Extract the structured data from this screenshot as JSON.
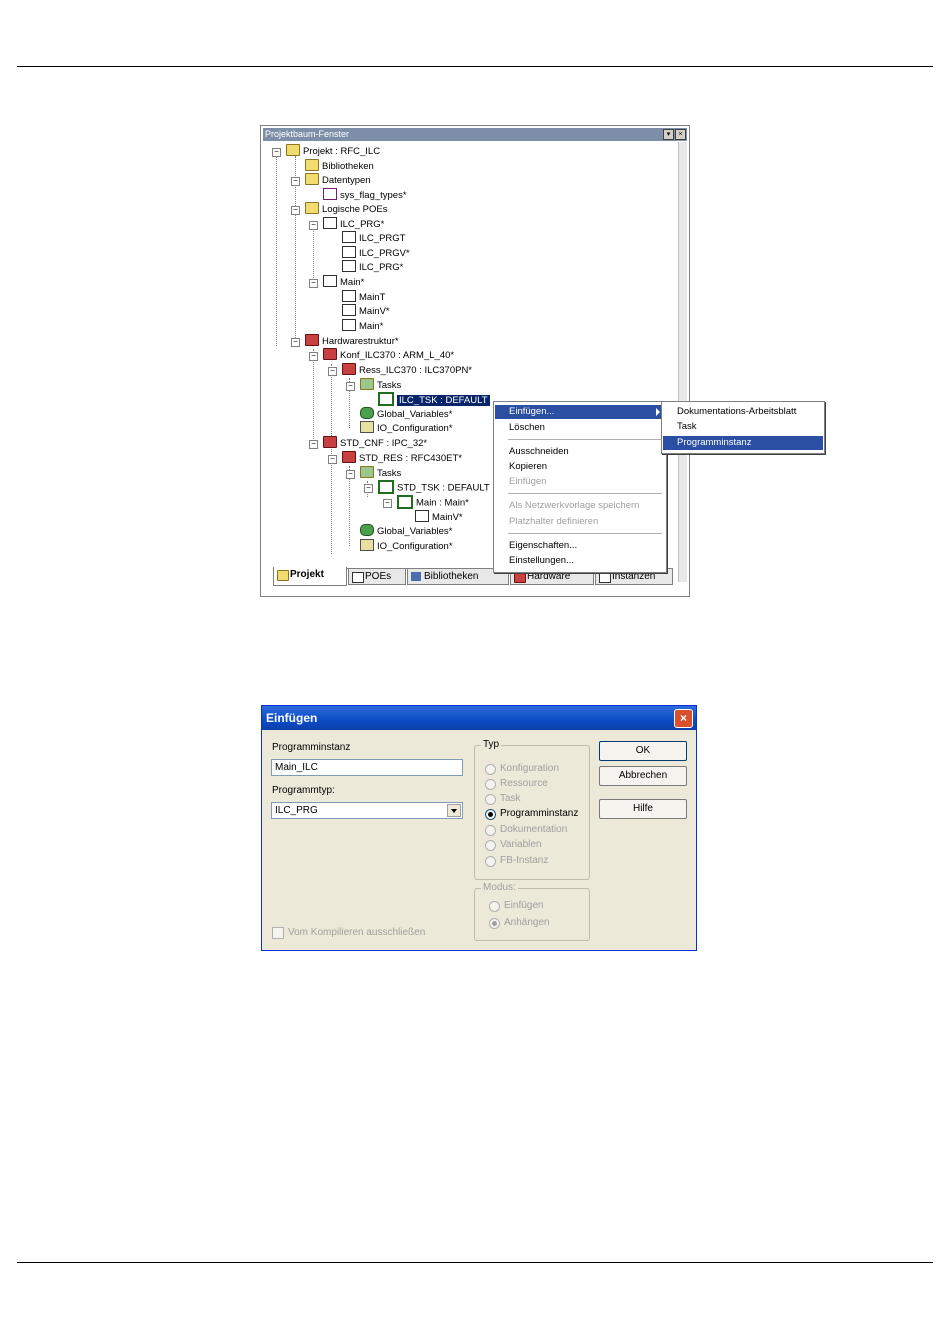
{
  "tree_window": {
    "title": "Projektbaum-Fenster",
    "nodes": [
      {
        "label": "Projekt : RFC_ILC"
      },
      {
        "label": "Bibliotheken"
      },
      {
        "label": "Datentypen"
      },
      {
        "label": "sys_flag_types*"
      },
      {
        "label": "Logische POEs"
      },
      {
        "label": "ILC_PRG*"
      },
      {
        "label": "ILC_PRGT"
      },
      {
        "label": "ILC_PRGV*"
      },
      {
        "label": "ILC_PRG*"
      },
      {
        "label": "Main*"
      },
      {
        "label": "MainT"
      },
      {
        "label": "MainV*"
      },
      {
        "label": "Main*"
      },
      {
        "label": "Hardwarestruktur*"
      },
      {
        "label": "Konf_ILC370 : ARM_L_40*"
      },
      {
        "label": "Ress_ILC370 : ILC370PN*"
      },
      {
        "label": "Tasks"
      },
      {
        "label": "ILC_TSK : DEFAULT"
      },
      {
        "label": "Global_Variables*"
      },
      {
        "label": "IO_Configuration*"
      },
      {
        "label": "STD_CNF : IPC_32*"
      },
      {
        "label": "STD_RES : RFC430ET*"
      },
      {
        "label": "Tasks"
      },
      {
        "label": "STD_TSK : DEFAULT"
      },
      {
        "label": "Main : Main*"
      },
      {
        "label": "MainV*"
      },
      {
        "label": "Global_Variables*"
      },
      {
        "label": "IO_Configuration*"
      }
    ],
    "tabs": [
      "Projekt",
      "POEs",
      "Bibliotheken",
      "Hardware",
      "Instanzen"
    ],
    "active_tab": "Projekt"
  },
  "context_menu": {
    "items": [
      "Einfügen...",
      "Löschen",
      "Ausschneiden",
      "Kopieren",
      "Einfügen",
      "Als Netzwerkvorlage speichern",
      "Platzhalter definieren",
      "Eigenschaften...",
      "Einstellungen..."
    ],
    "disabled": [
      "Einfügen",
      "Als Netzwerkvorlage speichern",
      "Platzhalter definieren"
    ]
  },
  "submenu": {
    "items": [
      "Dokumentations-Arbeitsblatt",
      "Task",
      "Programminstanz"
    ],
    "highlighted": "Programminstanz"
  },
  "dialog": {
    "title": "Einfügen",
    "programminstanz_label": "Programminstanz",
    "programminstanz_value": "Main_ILC",
    "programmtyp_label": "Programmtyp:",
    "programmtyp_value": "ILC_PRG",
    "typ_group_label": "Typ",
    "typ_options": [
      "Konfiguration",
      "Ressource",
      "Task",
      "Programminstanz",
      "Dokumentation",
      "Variablen",
      "FB-Instanz"
    ],
    "typ_selected": "Programminstanz",
    "modus_group_label": "Modus:",
    "modus_options": [
      "Einfügen",
      "Anhängen"
    ],
    "modus_selected": "Anhängen",
    "ok_label": "OK",
    "cancel_label": "Abbrechen",
    "help_label": "Hilfe",
    "exclude_checkbox_label": "Vom Kompilieren ausschließen",
    "exclude_checked": false
  }
}
